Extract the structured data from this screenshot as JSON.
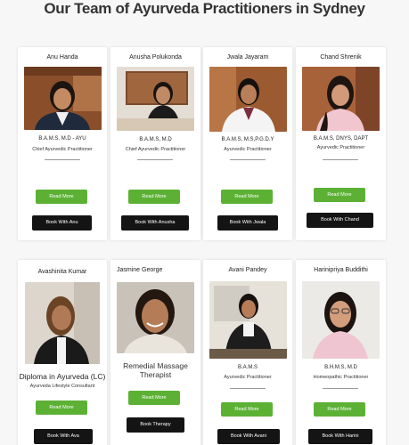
{
  "page_title": "Our Team of Ayurveda Practitioners in Sydney",
  "colors": {
    "accent": "#5cb135",
    "button_dark": "#141414"
  },
  "practitioners": [
    {
      "name": "Anu Handa",
      "credentials": "B.A.M.S, M.D - AYU",
      "role": "Chief Ayurvedic Practitioner",
      "read_more": "Read More",
      "book": "Book With Anu"
    },
    {
      "name": "Anusha Polukonda",
      "credentials": "B.A.M.S, M.D",
      "role": "Chief Ayurvedic Practitioner",
      "read_more": "Read More",
      "book": "Book With Anusha"
    },
    {
      "name": "Jwala Jayaram",
      "credentials": "B.A.M.S, M.S,P.G.D.Y",
      "role": "Ayurvedic Practitioner",
      "read_more": "Read More",
      "book": "Book With Jwala"
    },
    {
      "name": "Chand Shrenik",
      "credentials": "B.A.M.S, DNYS, DAPT",
      "role": "Ayurvedic Practitioner",
      "read_more": "Read More",
      "book": "Book With Chand"
    },
    {
      "name": "Avashinita Kumar",
      "credentials": "Diploma in Ayurveda (LC)",
      "role": "Ayurveda Lifestyle Consultant",
      "read_more": "Read More",
      "book": "Book With Ava"
    },
    {
      "name": "Jasmine George",
      "credentials": "",
      "role": "Remedial Massage Therapist",
      "read_more": "Read More",
      "book": "Book Therapy"
    },
    {
      "name": "Avani Pandey",
      "credentials": "B.A.M.S",
      "role": "Ayurvedic Practitioner",
      "read_more": "Read More",
      "book": "Book With Avani"
    },
    {
      "name": "Harinipriya Buddithi",
      "credentials": "B.H.M.S, M.D",
      "role": "Homeopathic Practitioner",
      "read_more": "Read More",
      "book": "Book With Harini"
    }
  ]
}
